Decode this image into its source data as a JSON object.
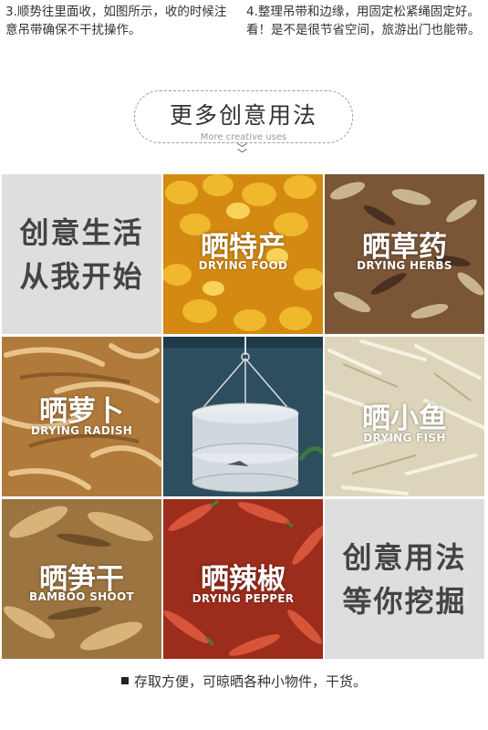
{
  "notes": {
    "left": "3.顺势往里面收，如图所示，收的时候注意吊带确保不干扰操作。",
    "right": "4.整理吊带和边缘，用固定松紧绳固定好。看！是不是很节省空间，旅游出门也能带。"
  },
  "heading": {
    "title": "更多创意用法",
    "subtitle": "More creative uses"
  },
  "grid": {
    "tile1": {
      "line1": "创意生活",
      "line2": "从我开始"
    },
    "tile2": {
      "cn": "晒特产",
      "en": "DRYING FOOD"
    },
    "tile3": {
      "cn": "晒草药",
      "en": "DRYING HERBS"
    },
    "tile4": {
      "cn": "晒萝卜",
      "en": "DRYING RADISH"
    },
    "tile6": {
      "cn": "晒小鱼",
      "en": "DRYING FISH"
    },
    "tile7": {
      "cn": "晒笋干",
      "en": "BAMBOO SHOOT"
    },
    "tile8": {
      "cn": "晒辣椒",
      "en": "DRYING PEPPER"
    },
    "tile9": {
      "line1": "创意用法",
      "line2": "等你挖掘"
    }
  },
  "bottom_text": "存取方便，可晾晒各种小物件，干货。",
  "colors": {
    "text_tile_bg": "#dedede",
    "food": "#e6a21f",
    "herbs": "#7a5636",
    "radish": "#c89a56",
    "fish": "#ece6cf",
    "bamboo": "#b08a54",
    "pepper": "#c0402a"
  }
}
